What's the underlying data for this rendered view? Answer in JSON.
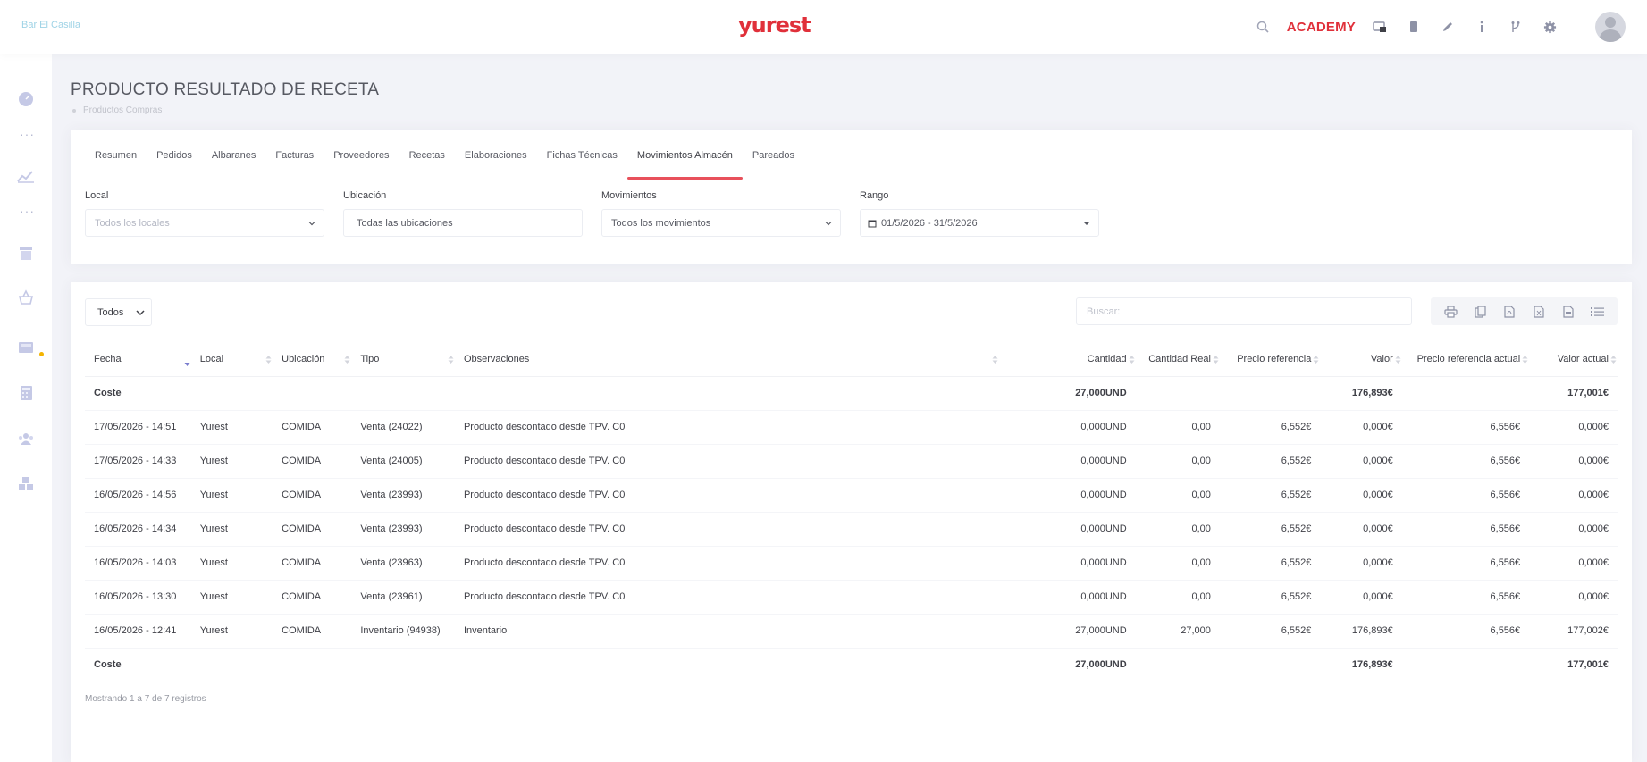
{
  "header": {
    "brand": "Bar El Casilla",
    "logo": "yurest",
    "academy": "ACADEMY",
    "icons": [
      "search-icon",
      "support-icon",
      "book-icon",
      "pencil-icon",
      "info-icon",
      "branch-icon",
      "gear-icon",
      "avatar-icon"
    ]
  },
  "sidebar": {
    "icons": [
      "dashboard-icon",
      "chart-icon",
      "store-icon",
      "basket-icon",
      "cash-register-icon",
      "calculator-icon",
      "users-icon",
      "boxes-icon"
    ]
  },
  "page": {
    "title": "PRODUCTO RESULTADO DE RECETA",
    "breadcrumb": "Productos Compras"
  },
  "tabs": [
    "Resumen",
    "Pedidos",
    "Albaranes",
    "Facturas",
    "Proveedores",
    "Recetas",
    "Elaboraciones",
    "Fichas Técnicas",
    "Movimientos Almacén",
    "Pareados"
  ],
  "active_tab": "Movimientos Almacén",
  "filters": {
    "local": {
      "label": "Local",
      "placeholder": "Todos los locales"
    },
    "ubicacion": {
      "label": "Ubicación",
      "value": "Todas las ubicaciones"
    },
    "movimientos": {
      "label": "Movimientos",
      "value": "Todos los movimientos"
    },
    "rango": {
      "label": "Rango",
      "value": "01/5/2026 - 31/5/2026"
    }
  },
  "table_controls": {
    "length": "Todos",
    "search_placeholder": "Buscar:",
    "export_icons": [
      "print-icon",
      "copy-icon",
      "pdf-icon",
      "excel-icon",
      "csv-icon",
      "columns-icon"
    ]
  },
  "table": {
    "columns": [
      "Fecha",
      "Local",
      "Ubicación",
      "Tipo",
      "Observaciones",
      "Cantidad",
      "Cantidad Real",
      "Precio referencia",
      "Valor",
      "Precio referencia actual",
      "Valor actual"
    ],
    "header_total": [
      "Coste",
      "",
      "",
      "",
      "",
      "27,000UND",
      "",
      "",
      "176,893€",
      "",
      "177,001€"
    ],
    "rows": [
      [
        "17/05/2026 - 14:51",
        "Yurest",
        "COMIDA",
        "Venta (24022)",
        "Producto descontado desde TPV. C0",
        "0,000UND",
        "0,00",
        "6,552€",
        "0,000€",
        "6,556€",
        "0,000€"
      ],
      [
        "17/05/2026 - 14:33",
        "Yurest",
        "COMIDA",
        "Venta (24005)",
        "Producto descontado desde TPV. C0",
        "0,000UND",
        "0,00",
        "6,552€",
        "0,000€",
        "6,556€",
        "0,000€"
      ],
      [
        "16/05/2026 - 14:56",
        "Yurest",
        "COMIDA",
        "Venta (23993)",
        "Producto descontado desde TPV. C0",
        "0,000UND",
        "0,00",
        "6,552€",
        "0,000€",
        "6,556€",
        "0,000€"
      ],
      [
        "16/05/2026 - 14:34",
        "Yurest",
        "COMIDA",
        "Venta (23993)",
        "Producto descontado desde TPV. C0",
        "0,000UND",
        "0,00",
        "6,552€",
        "0,000€",
        "6,556€",
        "0,000€"
      ],
      [
        "16/05/2026 - 14:03",
        "Yurest",
        "COMIDA",
        "Venta (23963)",
        "Producto descontado desde TPV. C0",
        "0,000UND",
        "0,00",
        "6,552€",
        "0,000€",
        "6,556€",
        "0,000€"
      ],
      [
        "16/05/2026 - 13:30",
        "Yurest",
        "COMIDA",
        "Venta (23961)",
        "Producto descontado desde TPV. C0",
        "0,000UND",
        "0,00",
        "6,552€",
        "0,000€",
        "6,556€",
        "0,000€"
      ],
      [
        "16/05/2026 - 12:41",
        "Yurest",
        "COMIDA",
        "Inventario (94938)",
        "Inventario",
        "27,000UND",
        "27,000",
        "6,552€",
        "176,893€",
        "6,556€",
        "177,002€"
      ]
    ],
    "footer_total": [
      "Coste",
      "",
      "",
      "",
      "",
      "27,000UND",
      "",
      "",
      "176,893€",
      "",
      "177,001€"
    ]
  },
  "table_info": "Mostrando 1 a 7 de 7 registros",
  "colors": {
    "accent": "#e8505b",
    "logo": "#e0303a",
    "warning_dot": "#f4b400"
  }
}
